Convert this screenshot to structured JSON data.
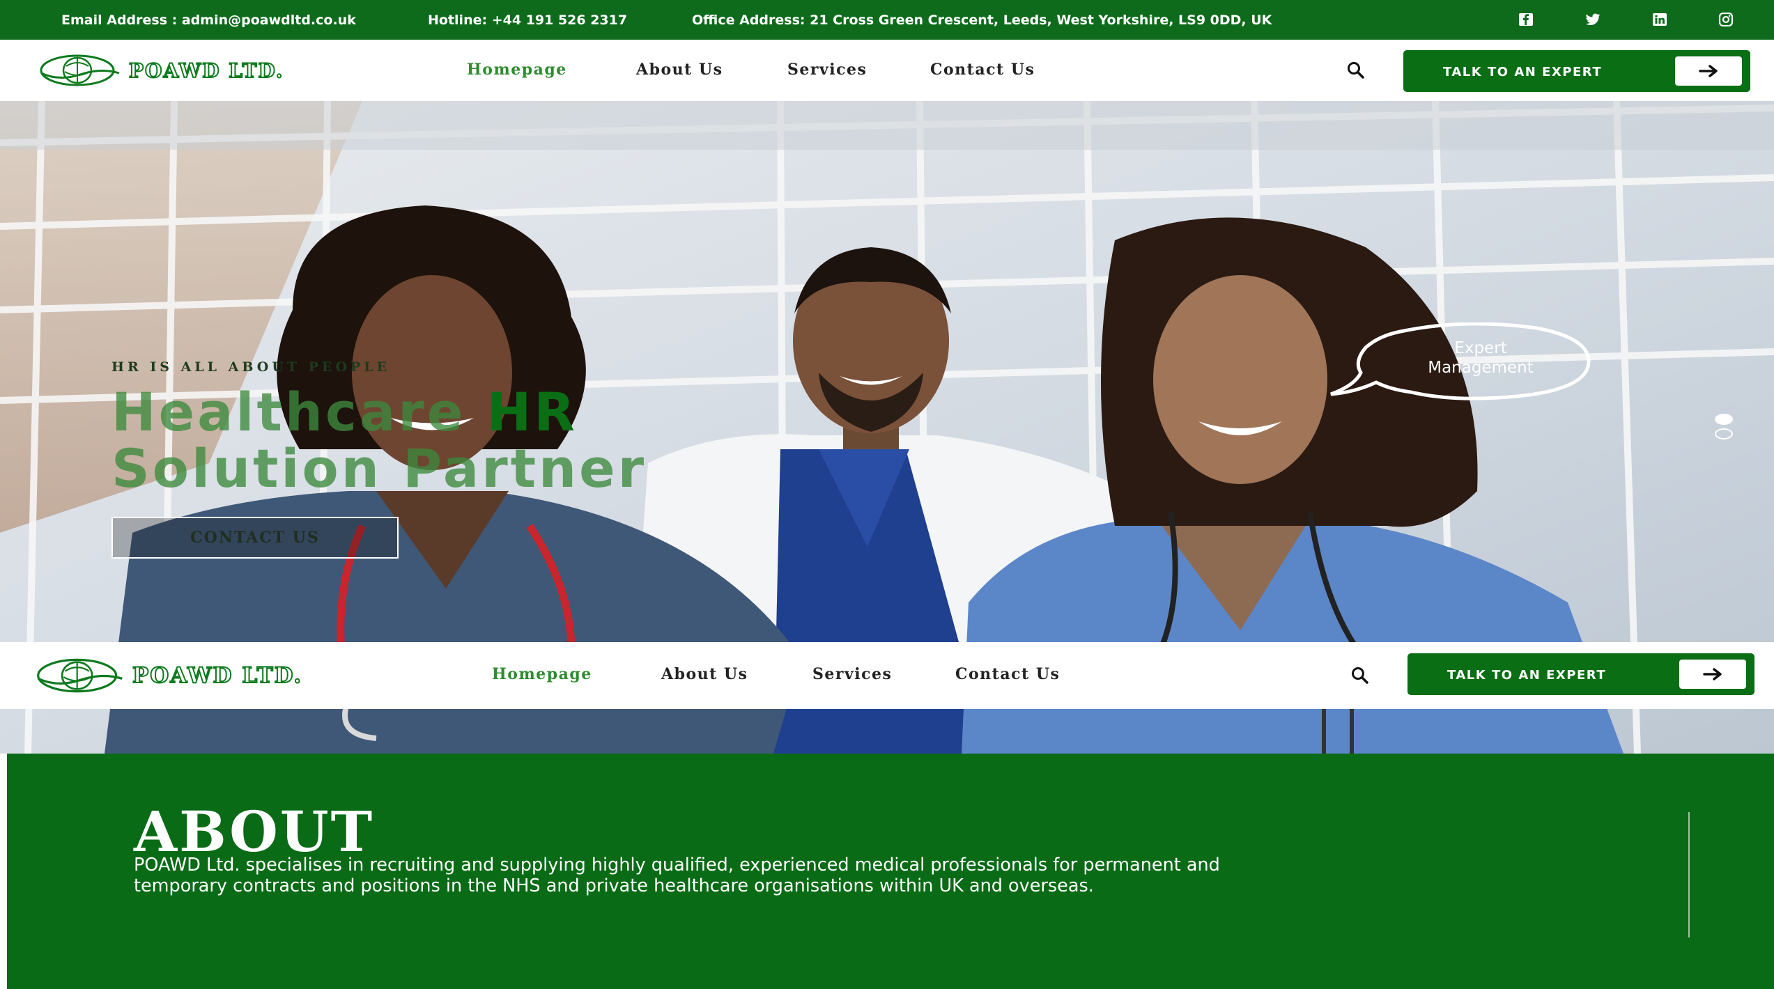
{
  "topbar": {
    "email": "Email Address : admin@poawdltd.co.uk",
    "hotline": "Hotline: +44 191 526 2317",
    "address": "Office Address: 21 Cross Green Crescent, Leeds, West Yorkshire, LS9 0DD, UK",
    "social_icons": [
      "facebook-icon",
      "twitter-icon",
      "linkedin-icon",
      "instagram-icon"
    ]
  },
  "header": {
    "logo_text": "POAWD LTD.",
    "nav": [
      "Homepage",
      "About Us",
      "Services",
      "Contact Us"
    ],
    "active_nav": "Homepage",
    "cta_label": "TALK TO AN EXPERT"
  },
  "sticky_header": {
    "logo_text": "POAWD LTD.",
    "nav": [
      "Homepage",
      "About Us",
      "Services",
      "Contact Us"
    ],
    "cta_label": "TALK TO AN EXPERT"
  },
  "hero": {
    "eyebrow": "HR IS ALL ABOUT PEOPLE",
    "headline_part1": "Healthcare",
    "headline_part2": "HR",
    "headline_line2": "Solution Partner",
    "button_label": "CONTACT US",
    "bubble_line1": "Expert",
    "bubble_line2": "Management",
    "slides": 2,
    "active_slide": 1
  },
  "about": {
    "title": "ABOUT",
    "text": "POAWD Ltd. specialises in recruiting and supplying highly qualified, experienced medical professionals for permanent and temporary contracts and positions in the NHS and private healthcare organisations within UK and overseas."
  },
  "colors": {
    "brand_green": "#0a6e14",
    "topbar_green": "#0e6b1c",
    "nav_active": "#2e8b2e",
    "scrub_blue": "#5b87c9",
    "scrub_navy": "#1f3f8f"
  }
}
